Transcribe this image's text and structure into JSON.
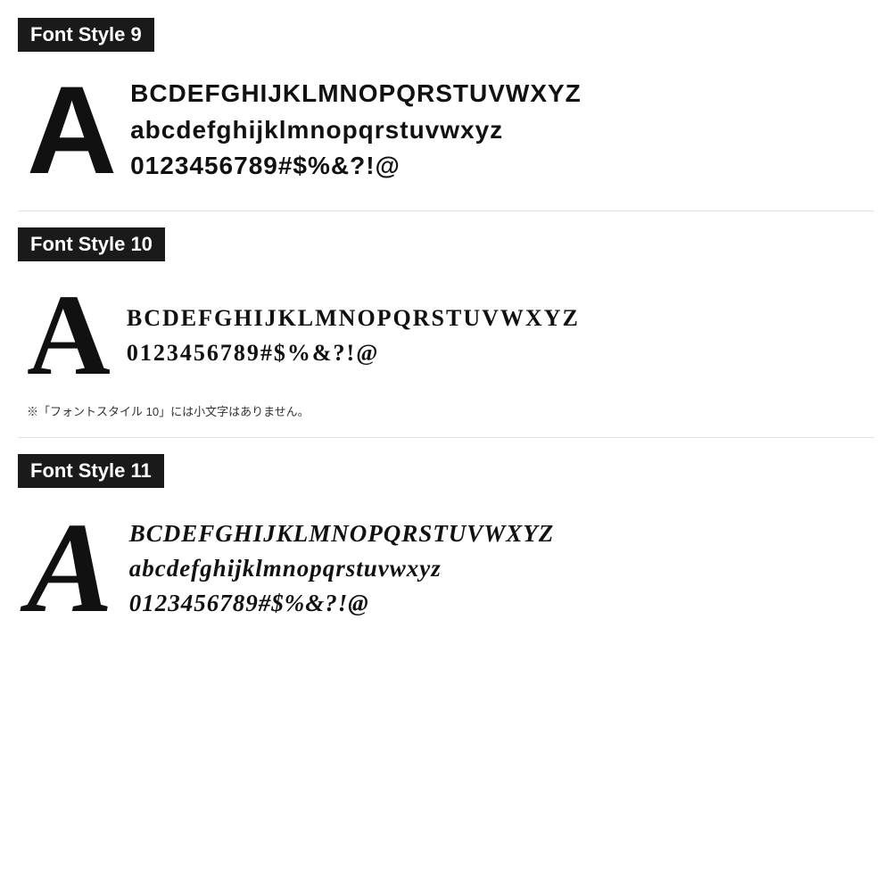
{
  "font_styles": [
    {
      "id": "style9",
      "label": "Font Style 9",
      "big_letter": "A",
      "lines": [
        "BCDEFGHIJKLMNOPQRSTUVWXYZ",
        "abcdefghijklmnopqrstuvwxyz",
        "0123456789#$%&?!@"
      ],
      "note": null
    },
    {
      "id": "style10",
      "label": "Font Style 10",
      "big_letter": "A",
      "lines": [
        "BCDEFGHIJKLMNOPQRSTUVWXYZ",
        "0123456789#$%&?!@"
      ],
      "note": "※「フォントスタイル 10」には小文字はありません。"
    },
    {
      "id": "style11",
      "label": "Font Style 11",
      "big_letter": "A",
      "lines": [
        "BCDEFGHIJKLMNOPQRSTUVWXYZ",
        "abcdefghijklmnopqrstuvwxyz",
        "0123456789#$%&?!@"
      ],
      "note": null
    }
  ]
}
